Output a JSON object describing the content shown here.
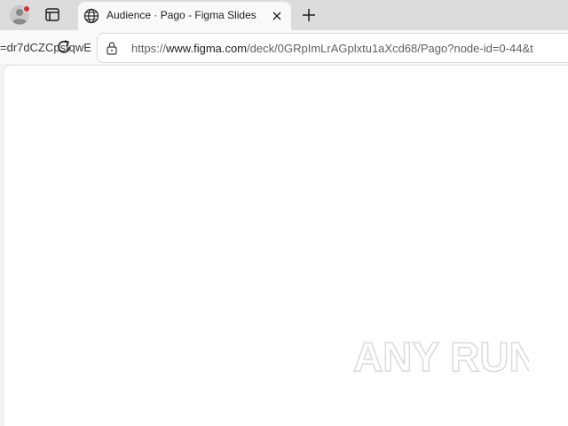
{
  "tab": {
    "title": "Audience · Pago - Figma Slides"
  },
  "address_bar": {
    "leftover_text": "=dr7dCZCpstqwE",
    "url_prefix": "https://",
    "url_host": "www.figma.com",
    "url_path": "/deck/0GRpImLrAGplxtu1aXcd68/Pago?node-id=0-44&t"
  },
  "watermark": {
    "text": "ANY RUN"
  },
  "icons": {
    "profile": "profile-avatar-icon",
    "tab_actions": "tab-actions-icon",
    "favicon": "globe-icon",
    "close": "close-icon",
    "new_tab": "plus-icon",
    "reload": "reload-icon",
    "lock": "lock-icon"
  },
  "colors": {
    "notification_dot": "#d32f2f",
    "tabstrip": "#dcdcdc",
    "content": "#ffffff"
  }
}
